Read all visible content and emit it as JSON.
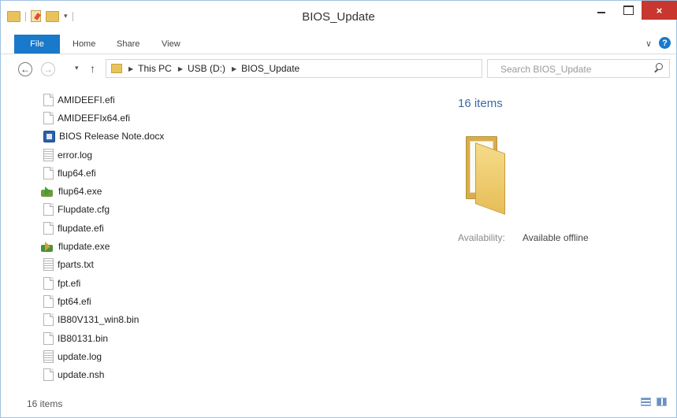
{
  "window": {
    "title": "BIOS_Update"
  },
  "title_buttons": {
    "minimize": "minimize-icon",
    "maximize": "maximize-icon",
    "close": "×"
  },
  "ribbon": {
    "tabs": {
      "file": "File",
      "home": "Home",
      "share": "Share",
      "view": "View"
    },
    "expand": "∨",
    "help": "?"
  },
  "navigation": {
    "back": "←",
    "forward": "→",
    "recent": "▾",
    "up": "↑",
    "breadcrumbs": [
      "This PC",
      "USB (D:)",
      "BIOS_Update"
    ],
    "separator": "▶",
    "dropdown": "∨",
    "refresh": "↻"
  },
  "search": {
    "placeholder": "Search BIOS_Update"
  },
  "files": [
    {
      "name": "AMIDEEFI.efi",
      "icon": "blank-file-icon"
    },
    {
      "name": "AMIDEEFIx64.efi",
      "icon": "blank-file-icon"
    },
    {
      "name": "BIOS Release Note.docx",
      "icon": "word-document-icon"
    },
    {
      "name": "error.log",
      "icon": "text-file-icon"
    },
    {
      "name": "flup64.efi",
      "icon": "blank-file-icon"
    },
    {
      "name": "flup64.exe",
      "icon": "executable-icon"
    },
    {
      "name": "Flupdate.cfg",
      "icon": "blank-file-icon"
    },
    {
      "name": "flupdate.efi",
      "icon": "blank-file-icon"
    },
    {
      "name": "flupdate.exe",
      "icon": "executable-icon"
    },
    {
      "name": "fparts.txt",
      "icon": "text-file-icon"
    },
    {
      "name": "fpt.efi",
      "icon": "blank-file-icon"
    },
    {
      "name": "fpt64.efi",
      "icon": "blank-file-icon"
    },
    {
      "name": "IB80V131_win8.bin",
      "icon": "blank-file-icon"
    },
    {
      "name": "IB80131.bin",
      "icon": "blank-file-icon"
    },
    {
      "name": "update.log",
      "icon": "text-file-icon"
    },
    {
      "name": "update.nsh",
      "icon": "blank-file-icon"
    }
  ],
  "details": {
    "count": "16 items",
    "availability_label": "Availability:",
    "availability_value": "Available offline"
  },
  "status": {
    "text": "16 items"
  },
  "colors": {
    "accent": "#1979ca",
    "close_button": "#c7372f",
    "folder": "#e7bd57",
    "details_heading": "#3b6aa6"
  }
}
